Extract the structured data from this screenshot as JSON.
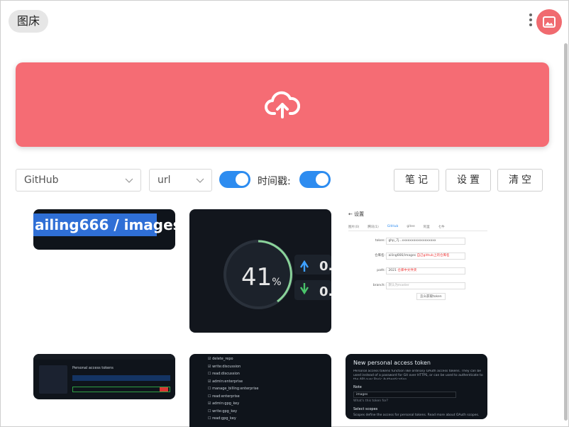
{
  "app": {
    "title": "图床"
  },
  "controls": {
    "provider": "GitHub",
    "link_format": "url",
    "timestamp_label": "时间戳:",
    "notes_label": "笔记",
    "settings_label": "设置",
    "clear_label": "清空"
  },
  "images": [
    {
      "text": "ailing666 / images"
    },
    {
      "percent": "41",
      "unit": "%",
      "stat_value": "0."
    },
    {
      "header": "设置",
      "tabs": [
        "图片(0)",
        "腾讯(1)",
        "GitHub",
        "gitee",
        "阿里",
        "七牛"
      ],
      "rows": [
        {
          "label": "token:",
          "value": "ghp_7j...xxxxxxxxxxxxxxxxxx"
        },
        {
          "label": "仓库名:",
          "value": "ailing666/images",
          "note": "自己github上的仓库名"
        },
        {
          "label": "path:",
          "value": "2021",
          "note": "仓库中文件夹"
        },
        {
          "label": "branch:",
          "value": "默认为master"
        }
      ],
      "button": "怎么获取token"
    },
    {
      "title": "Personal access tokens"
    },
    {
      "items": [
        "delete_repo",
        "write:discussion",
        "read:discussion",
        "admin:enterprise",
        "manage_billing:enterprise",
        "read:enterprise",
        "admin:gpg_key",
        "write:gpg_key",
        "read:gpg_key"
      ]
    },
    {
      "title": "New personal access token",
      "desc": "Personal access tokens function like ordinary OAuth access tokens. They can be used instead of a password for Git over HTTPS, or can be used to authenticate to the API over Basic Authentication.",
      "note_label": "Note",
      "note_value": "images",
      "note_hint": "What's this token for?",
      "scopes_label": "Select scopes",
      "scopes_desc": "Scopes define the access for personal tokens. Read more about OAuth scopes."
    }
  ],
  "colors": {
    "accent": "#f56c74",
    "toggle": "#2d8cf0"
  }
}
